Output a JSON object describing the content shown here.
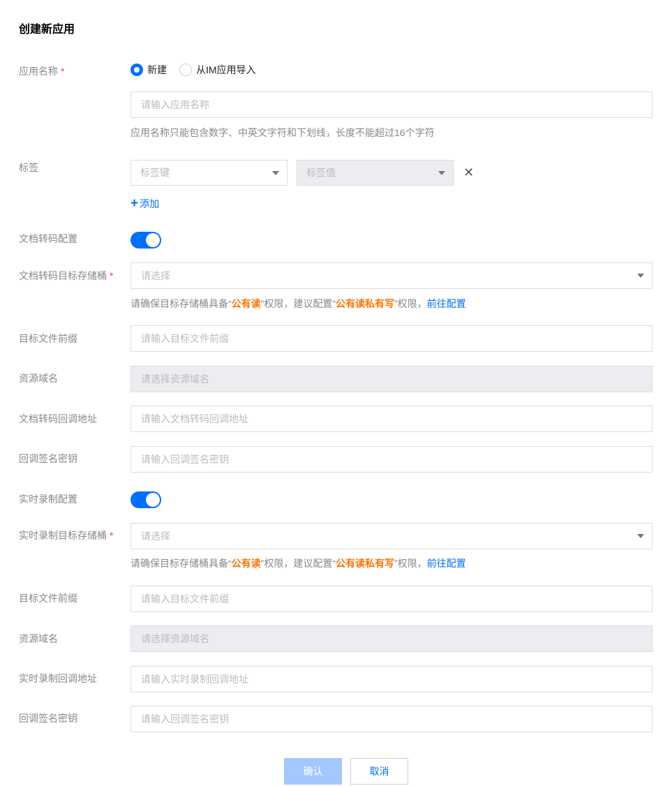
{
  "page": {
    "title": "创建新应用"
  },
  "app_name": {
    "label": "应用名称",
    "required_mark": "*",
    "radio_new": "新建",
    "radio_import": "从IM应用导入",
    "placeholder": "请输入应用名称",
    "hint": "应用名称只能包含数字、中英文字符和下划线，长度不能超过16个字符"
  },
  "tags": {
    "label": "标签",
    "key_placeholder": "标签键",
    "value_placeholder": "标签值",
    "remove": "✕",
    "add_icon": "+",
    "add_label": "添加"
  },
  "doc_transcode": {
    "config_label": "文档转码配置",
    "bucket_label": "文档转码目标存储桶",
    "required_mark": "*",
    "bucket_placeholder": "请选择",
    "hint_prefix": "请确保目标存储桶具备“",
    "hint_perm1": "公有读",
    "hint_mid": "”权限，建议配置“",
    "hint_perm2": "公有读私有写",
    "hint_suffix": "”权限，",
    "hint_link": "前往配置",
    "prefix_label": "目标文件前缀",
    "prefix_placeholder": "请输入目标文件前缀",
    "domain_label": "资源域名",
    "domain_placeholder": "请选择资源域名",
    "callback_label": "文档转码回调地址",
    "callback_placeholder": "请输入文档转码回调地址",
    "sign_label": "回调签名密钥",
    "sign_placeholder": "请输入回调签名密钥"
  },
  "realtime_record": {
    "config_label": "实时录制配置",
    "bucket_label": "实时录制目标存储桶",
    "required_mark": "*",
    "bucket_placeholder": "请选择",
    "hint_prefix": "请确保目标存储桶具备“",
    "hint_perm1": "公有读",
    "hint_mid": "”权限，建议配置“",
    "hint_perm2": "公有读私有写",
    "hint_suffix": "”权限，",
    "hint_link": "前往配置",
    "prefix_label": "目标文件前缀",
    "prefix_placeholder": "请输入目标文件前缀",
    "domain_label": "资源域名",
    "domain_placeholder": "请选择资源域名",
    "callback_label": "实时录制回调地址",
    "callback_placeholder": "请输入实时录制回调地址",
    "sign_label": "回调签名密钥",
    "sign_placeholder": "请输入回调签名密钥"
  },
  "buttons": {
    "confirm": "确认",
    "cancel": "取消"
  },
  "colors": {
    "primary": "#006eff",
    "warning": "#ff7200",
    "required": "#e54545"
  }
}
